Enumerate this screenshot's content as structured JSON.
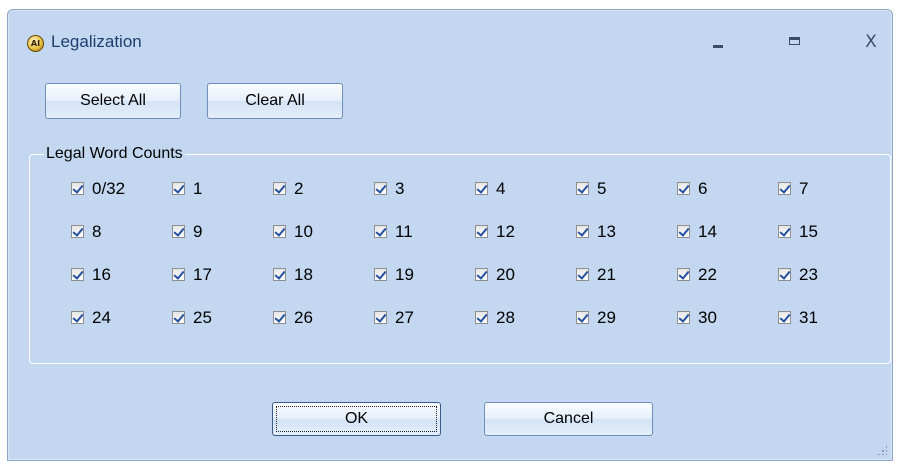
{
  "window": {
    "title": "Legalization",
    "icon": "app-logo-icon",
    "icon_text": "AI",
    "close_glyph": "X"
  },
  "toolbar": {
    "select_all_label": "Select All",
    "clear_all_label": "Clear All"
  },
  "group": {
    "label": "Legal Word Counts",
    "checkboxes": [
      {
        "label": "0/32",
        "checked": true
      },
      {
        "label": "1",
        "checked": true
      },
      {
        "label": "2",
        "checked": true
      },
      {
        "label": "3",
        "checked": true
      },
      {
        "label": "4",
        "checked": true
      },
      {
        "label": "5",
        "checked": true
      },
      {
        "label": "6",
        "checked": true
      },
      {
        "label": "7",
        "checked": true
      },
      {
        "label": "8",
        "checked": true
      },
      {
        "label": "9",
        "checked": true
      },
      {
        "label": "10",
        "checked": true
      },
      {
        "label": "11",
        "checked": true
      },
      {
        "label": "12",
        "checked": true
      },
      {
        "label": "13",
        "checked": true
      },
      {
        "label": "14",
        "checked": true
      },
      {
        "label": "15",
        "checked": true
      },
      {
        "label": "16",
        "checked": true
      },
      {
        "label": "17",
        "checked": true
      },
      {
        "label": "18",
        "checked": true
      },
      {
        "label": "19",
        "checked": true
      },
      {
        "label": "20",
        "checked": true
      },
      {
        "label": "21",
        "checked": true
      },
      {
        "label": "22",
        "checked": true
      },
      {
        "label": "23",
        "checked": true
      },
      {
        "label": "24",
        "checked": true
      },
      {
        "label": "25",
        "checked": true
      },
      {
        "label": "26",
        "checked": true
      },
      {
        "label": "27",
        "checked": true
      },
      {
        "label": "28",
        "checked": true
      },
      {
        "label": "29",
        "checked": true
      },
      {
        "label": "30",
        "checked": true
      },
      {
        "label": "31",
        "checked": true
      }
    ]
  },
  "footer": {
    "ok_label": "OK",
    "cancel_label": "Cancel"
  },
  "colors": {
    "window_background": "#c3d7f0",
    "title_text": "#1d3f70",
    "checkmark": "#2450a0"
  }
}
